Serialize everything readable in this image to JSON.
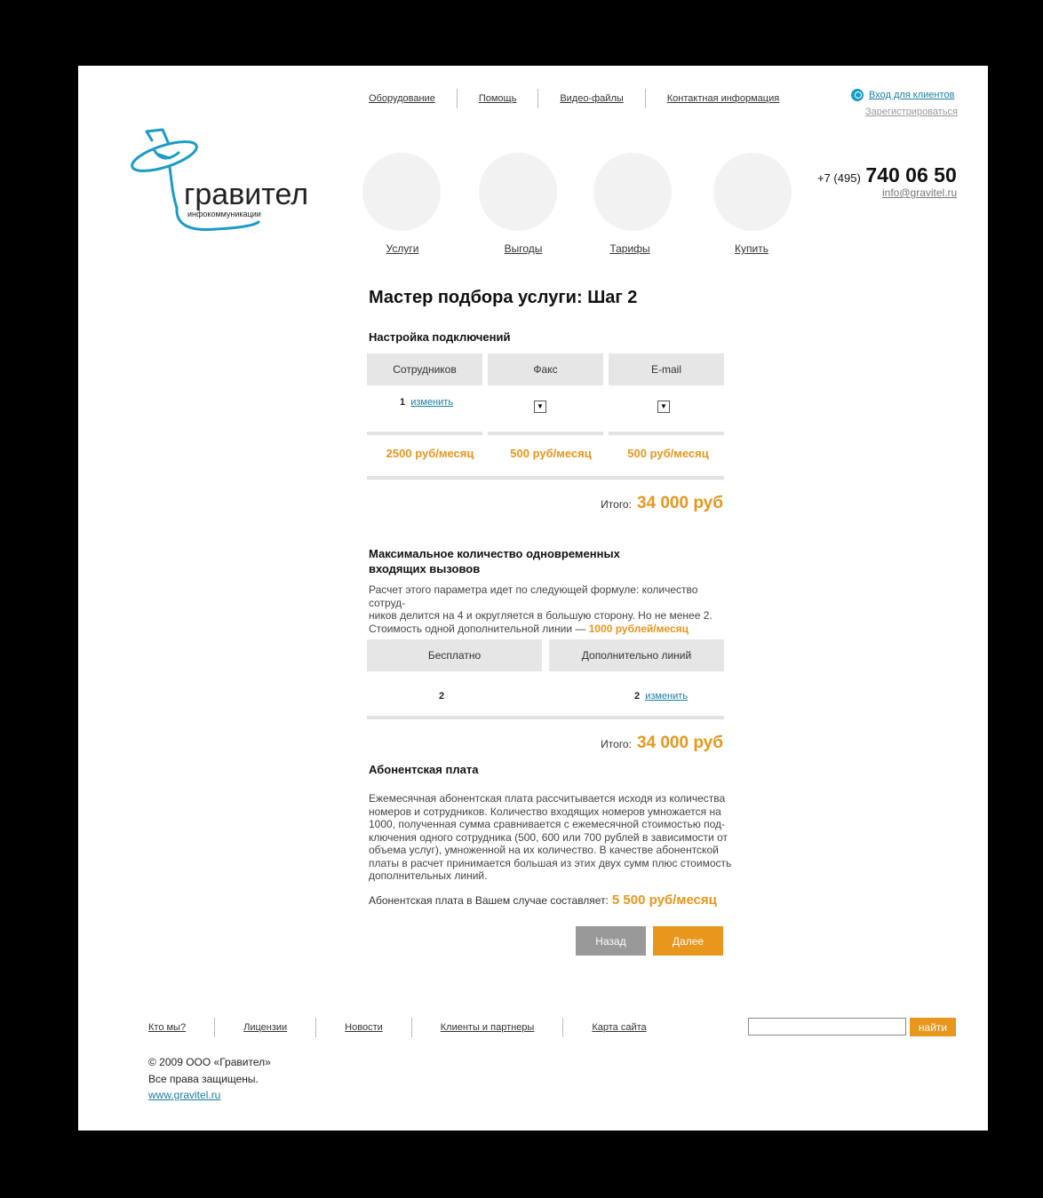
{
  "header": {
    "nav": [
      "Оборудование",
      "Помощь",
      "Видео-файлы",
      "Контактная информация"
    ],
    "login_label": "Вход для клиентов",
    "register_label": "Зарегистрироваться",
    "phone_prefix": "+7 (495)",
    "phone_number": "740 06 50",
    "email": "info@gravitel.ru",
    "logo_text": "гравител",
    "logo_subtext": "инфокоммуникации"
  },
  "menu": [
    "Услуги",
    "Выгоды",
    "Тарифы",
    "Купить"
  ],
  "main": {
    "title": "Мастер подбора услуги: Шаг 2",
    "connections": {
      "title": "Настройка подключений",
      "columns": [
        "Сотрудников",
        "Факс",
        "E-mail"
      ],
      "employees_value": "1",
      "change_label": "изменить",
      "prices": [
        "2500 руб/месяц",
        "500 руб/месяц",
        "500 руб/месяц"
      ],
      "total_label": "Итого:",
      "total_value": "34 000 руб"
    },
    "calls": {
      "title_line1": "Максимальное количество одновременных",
      "title_line2": "входящих вызовов",
      "desc_line1": "Расчет этого параметра идет по следующей формуле: количество сотруд-",
      "desc_line2": "ников делится на 4 и округляется в большую сторону. Но не менее 2.",
      "desc_line3": "Стоимость одной дополнительной линии —",
      "desc_highlight": "1000 рублей/месяц",
      "columns": [
        "Бесплатно",
        "Дополнительно линий"
      ],
      "free_value": "2",
      "extra_value": "2",
      "change_label": "изменить",
      "total_label": "Итого:",
      "total_value": "34 000 руб"
    },
    "fee": {
      "title": "Абонентская плата",
      "lines": [
        "Ежемесячная абонентская плата рассчитывается исходя из  количества",
        "номеров и сотрудников.  Количество входящих номеров умножается на",
        "1000, полученная сумма сравнивается с ежемесячной  стоимостью под-",
        "ключения одного сотрудника (500, 600 или 700 рублей в зависимости от",
        "объема услуг), умноженной на их количество.  В качестве абонентской",
        "платы в расчет принимается большая из этих двух сумм плюс стоимость",
        "дополнительных линий."
      ],
      "result_label": "Абонентская плата в Вашем случае  составляет:",
      "result_value": "5 500 руб/месяц"
    },
    "back_label": "Назад",
    "next_label": "Далее"
  },
  "footer": {
    "nav": [
      "Кто мы?",
      "Лицензии",
      "Новости",
      "Клиенты и партнеры",
      "Карта сайта"
    ],
    "search_button": "найти",
    "copyright": "© 2009 ООО «Гравител»",
    "rights": "Все права защищены.",
    "site": "www.gravitel.ru"
  },
  "colors": {
    "accent": "#e8961c",
    "link": "#1a7ea4",
    "brand": "#1a9cc6",
    "back_button": "#999999"
  }
}
